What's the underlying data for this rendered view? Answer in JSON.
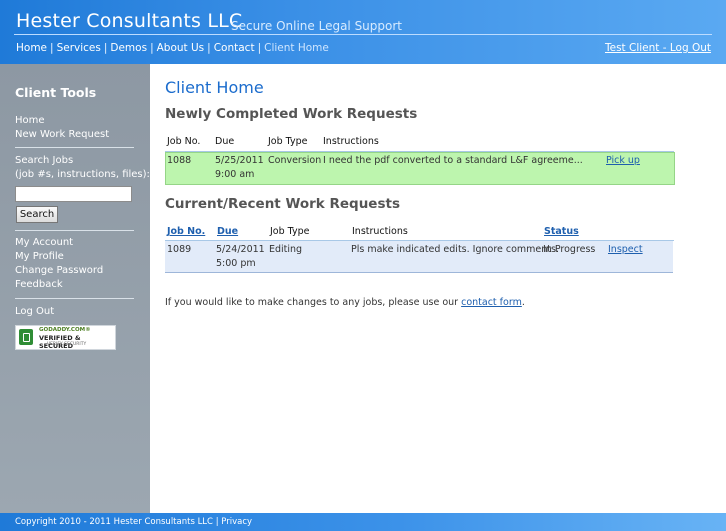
{
  "header": {
    "brand": "Hester Consultants LLC",
    "tagline": "Secure Online Legal Support",
    "nav": [
      {
        "label": "Home"
      },
      {
        "label": "Services"
      },
      {
        "label": "Demos"
      },
      {
        "label": "About Us"
      },
      {
        "label": "Contact"
      },
      {
        "label": "Client Home"
      }
    ],
    "account": "Test Client - Log Out"
  },
  "sidebar": {
    "title": "Client Tools",
    "links": [
      {
        "label": "Home"
      },
      {
        "label": "New Work Request"
      }
    ],
    "search": {
      "label_line1": "Search Jobs",
      "label_line2": "(job #s, instructions, files):",
      "value": "",
      "button": "Search"
    },
    "account_links": [
      {
        "label": "My Account"
      },
      {
        "label": "My Profile"
      },
      {
        "label": "Change Password"
      },
      {
        "label": "Feedback"
      }
    ],
    "logout": "Log Out",
    "seal": {
      "top": "GODADDY.COM®",
      "main": "VERIFIED & SECURED",
      "sub": "VERIFY SECURITY"
    }
  },
  "content": {
    "title": "Client Home",
    "completed": {
      "heading": "Newly Completed Work Requests",
      "columns": {
        "job_no": "Job No.",
        "due": "Due",
        "job_type": "Job Type",
        "instructions": "Instructions"
      },
      "rows": [
        {
          "job_no": "1088",
          "due_line1": "5/25/2011",
          "due_line2": "9:00 am",
          "job_type": "Conversion",
          "instructions": "I need the pdf converted to a standard L&F agreeme...",
          "action": "Pick up"
        }
      ]
    },
    "current": {
      "heading": "Current/Recent Work Requests",
      "columns": {
        "job_no": "Job No.",
        "due": "Due",
        "job_type": "Job Type",
        "instructions": "Instructions",
        "status": "Status"
      },
      "rows": [
        {
          "job_no": "1089",
          "due_line1": "5/24/2011",
          "due_line2": "5:00 pm",
          "job_type": "Editing",
          "instructions": "Pls make indicated edits. Ignore comments.",
          "status": "In Progress",
          "action": "Inspect"
        }
      ]
    },
    "note_prefix": "If you would like to make changes to any jobs, please use our",
    "note_link": "contact form",
    "note_suffix": "."
  },
  "footer": {
    "copyright": "Copyright 2010 - 2011 Hester Consultants LLC",
    "separator": "|",
    "privacy": "Privacy"
  }
}
